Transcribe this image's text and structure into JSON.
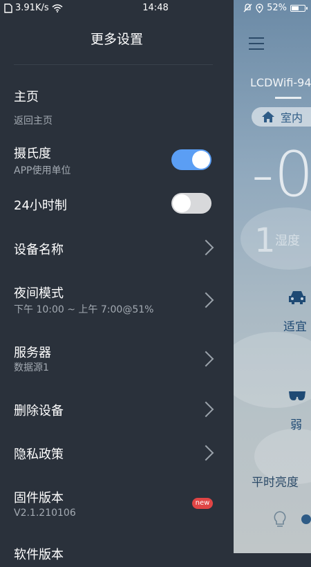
{
  "status": {
    "speed": "3.91K/s",
    "time": "14:48",
    "battery": "52%"
  },
  "background": {
    "device_name": "LCDWifi-94",
    "location_chip": "室内",
    "temp_big": "-0",
    "temp_small": "1",
    "humidity_char": "湿度",
    "comfort": "适宜",
    "fan": "弱",
    "brightness": "平时亮度"
  },
  "drawer": {
    "title": "更多设置",
    "home": {
      "label": "主页",
      "sub": "返回主页"
    },
    "celsius": {
      "label": "摄氏度",
      "sub": "APP使用单位",
      "on": true
    },
    "h24": {
      "label": "24小时制",
      "on": false
    },
    "device_name": {
      "label": "设备名称"
    },
    "night_mode": {
      "label": "夜间模式",
      "sub": "下午 10:00 ~ 上午 7:00@51%"
    },
    "server": {
      "label": "服务器",
      "sub": "数据源1"
    },
    "delete_device": {
      "label": "删除设备"
    },
    "privacy": {
      "label": "隐私政策"
    },
    "firmware": {
      "label": "固件版本",
      "sub": "V2.1.210106",
      "badge": "new"
    },
    "software": {
      "label": "软件版本"
    }
  }
}
